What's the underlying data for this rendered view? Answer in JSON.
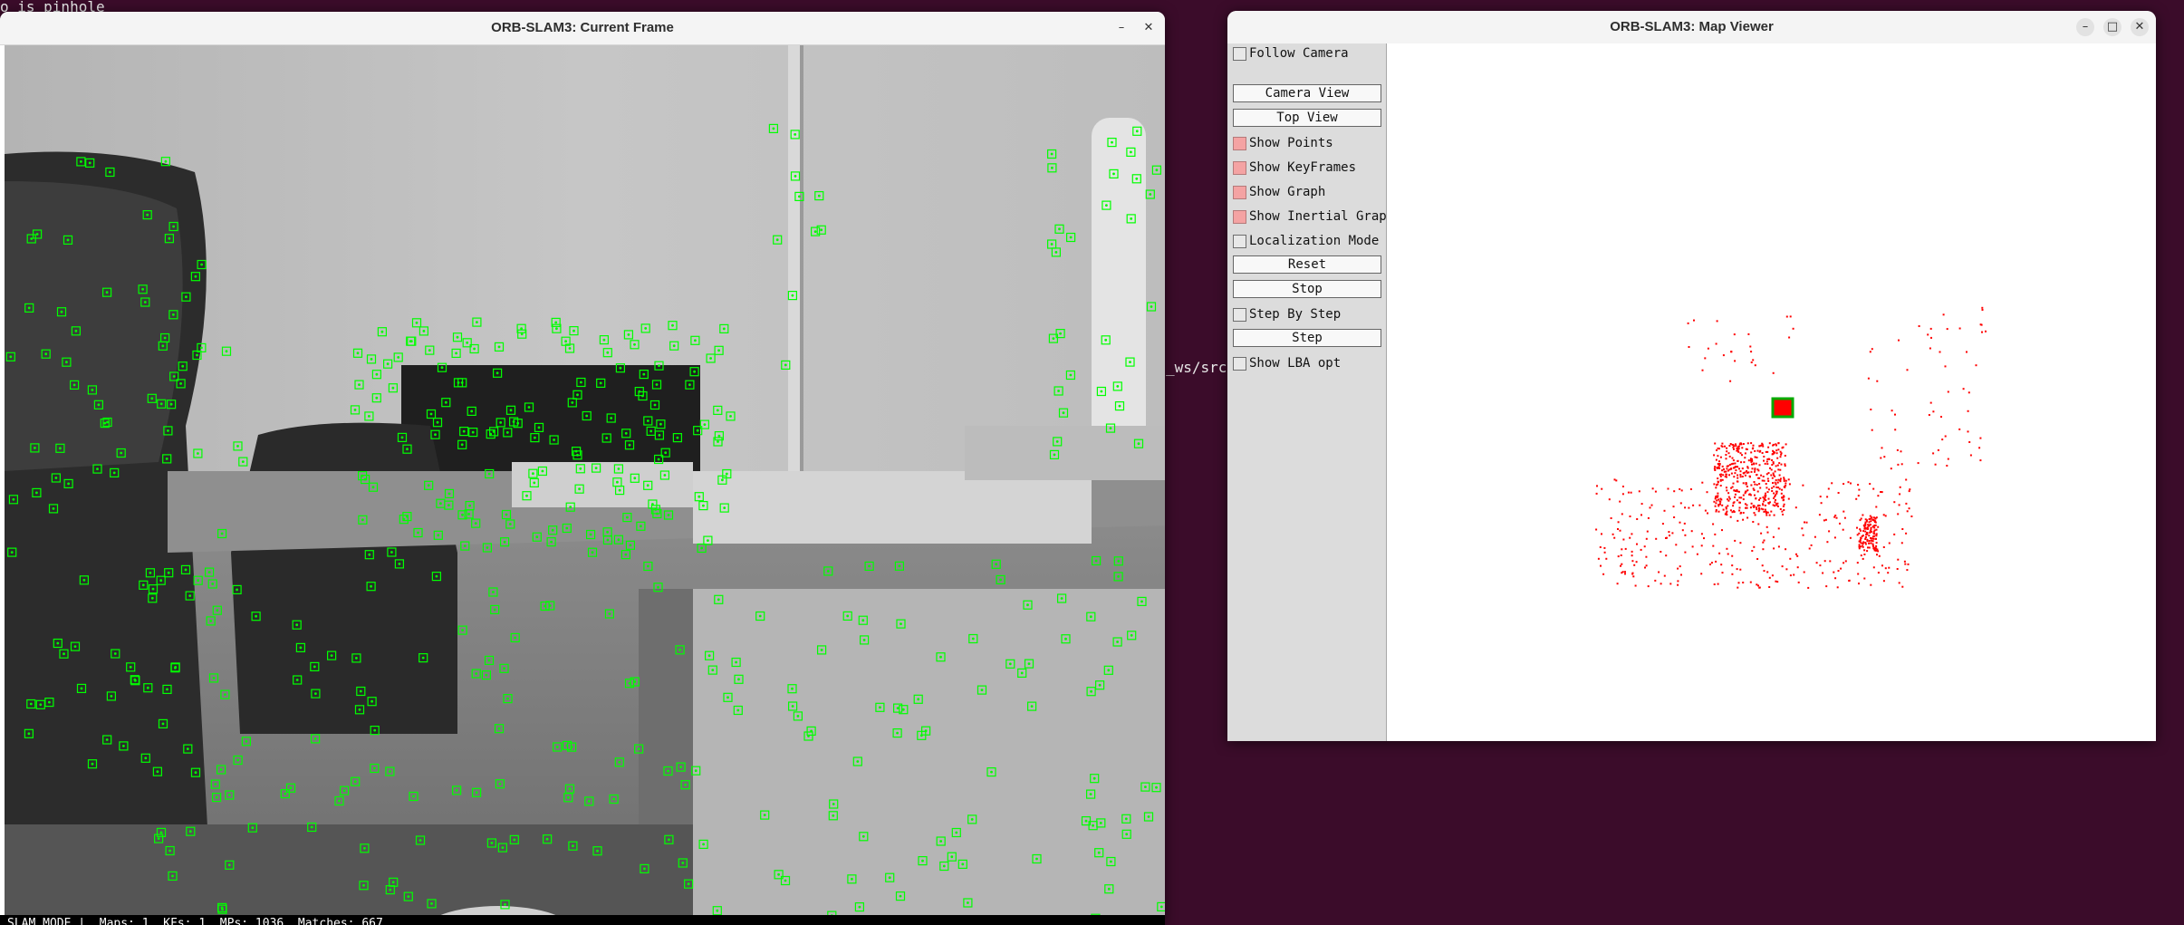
{
  "terminal": {
    "lines": [
      "o is pinhole",
      "_ws/src/"
    ]
  },
  "frame_window": {
    "title": "ORB-SLAM3: Current Frame",
    "minimize_glyph": "–",
    "close_glyph": "✕",
    "status_text": "SLAM MODE |  Maps: 1, KFs: 1, MPs: 1036, Matches: 667"
  },
  "map_window": {
    "title": "ORB-SLAM3: Map Viewer",
    "minimize_glyph": "–",
    "maximize_glyph": "□",
    "close_glyph": "✕"
  },
  "map_panel": {
    "follow_camera": {
      "label": "Follow Camera",
      "checked": false
    },
    "camera_view": "Camera View",
    "top_view": "Top View",
    "show_points": {
      "label": "Show Points",
      "checked": true
    },
    "show_keyframes": {
      "label": "Show KeyFrames",
      "checked": true
    },
    "show_graph": {
      "label": "Show Graph",
      "checked": true
    },
    "show_inertial_graph": {
      "label": "Show Inertial Graph",
      "checked": true
    },
    "localization_mode": {
      "label": "Localization Mode",
      "checked": false
    },
    "reset": "Reset",
    "stop": "Stop",
    "step_by_step": {
      "label": "Step By Step",
      "checked": false
    },
    "step": "Step",
    "show_lba_opt": {
      "label": "Show LBA opt",
      "checked": false
    }
  },
  "colors": {
    "feature_marker": "#00ff00",
    "map_point": "#ff0000",
    "keyframe_outline": "#00aa00",
    "keyframe_fill": "#ff0000",
    "desktop_background": "#3b0c2a",
    "checkbox_on": "#f4a3a3"
  },
  "icons": [
    "minimize-icon",
    "maximize-icon",
    "close-icon",
    "checkbox-icon"
  ]
}
